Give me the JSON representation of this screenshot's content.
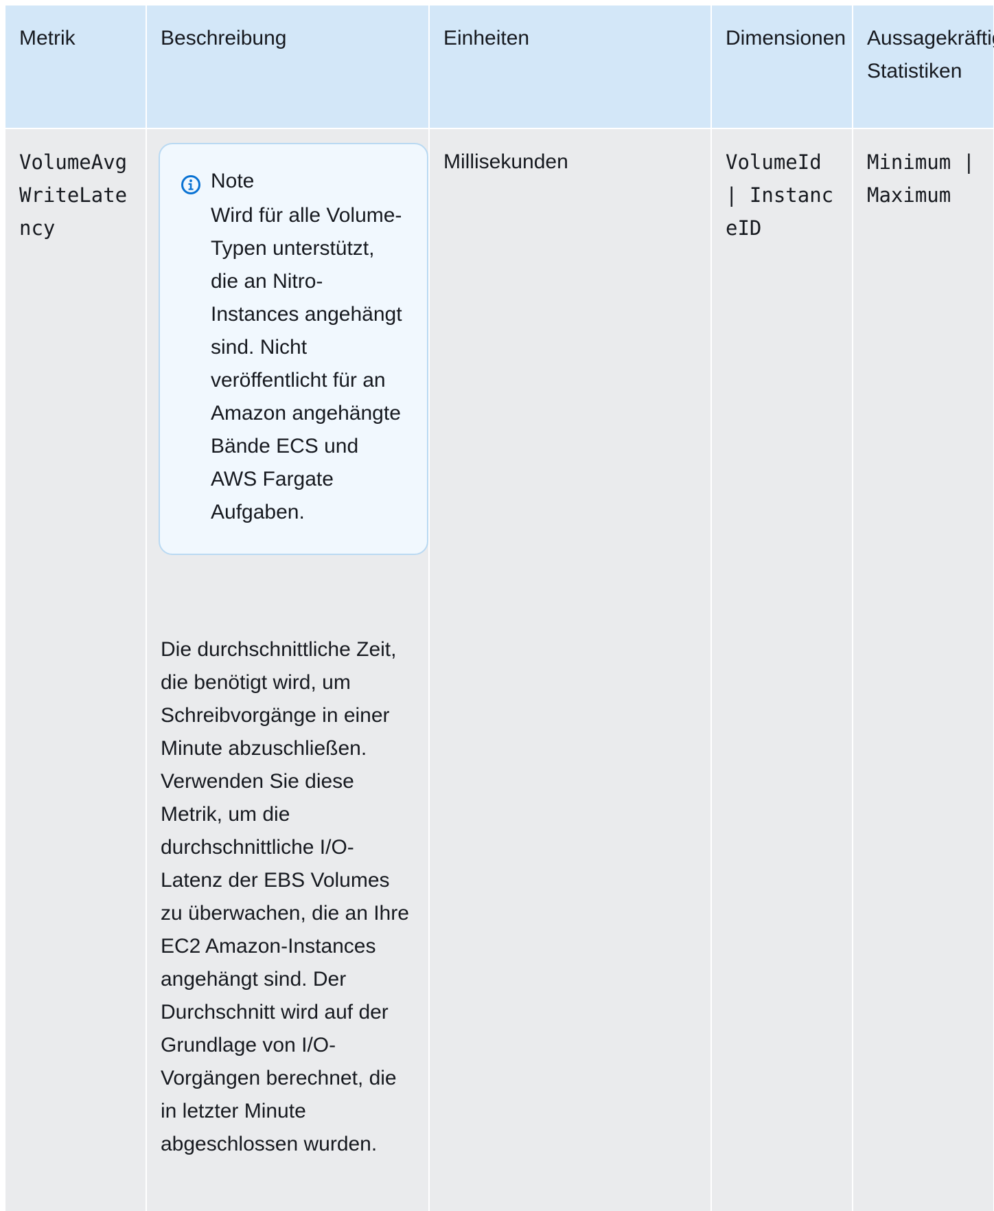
{
  "table": {
    "headers": {
      "metric": "Metrik",
      "description": "Beschreibung",
      "units": "Einheiten",
      "dimensions": "Dimensionen",
      "statistics": "Aussagekräftige Statistiken"
    },
    "row": {
      "metric": "VolumeAvgWriteLatency",
      "note_title": "Note",
      "note_text": "Wird für alle Volume-Typen unterstützt, die an Nitro-Instances angehängt sind. Nicht veröffentlicht für an Amazon angehängte Bände ECS und AWS Fargate Aufgaben.",
      "description": "Die durchschnittliche Zeit, die benötigt wird, um Schreibvorgänge in einer Minute abzuschließen. Verwenden Sie diese Metrik, um die durchschnittliche I/O-Latenz der EBS Volumes zu überwachen, die an Ihre EC2 Amazon-Instances angehängt sind. Der Durchschnitt wird auf der Grundlage von I/O-Vorgängen berechnet, die in letzter Minute abgeschlossen wurden.",
      "units": "Millisekunden",
      "dimensions": "VolumeId | InstanceID",
      "statistics": "Minimum | Maximum"
    }
  },
  "colors": {
    "header_bg": "#d3e7f8",
    "cell_bg": "#eaebed",
    "note_bg": "#f1f8fe",
    "note_border": "#b9d9f2",
    "info_icon": "#0972d3"
  },
  "icons": {
    "note": "info-circle-icon"
  }
}
